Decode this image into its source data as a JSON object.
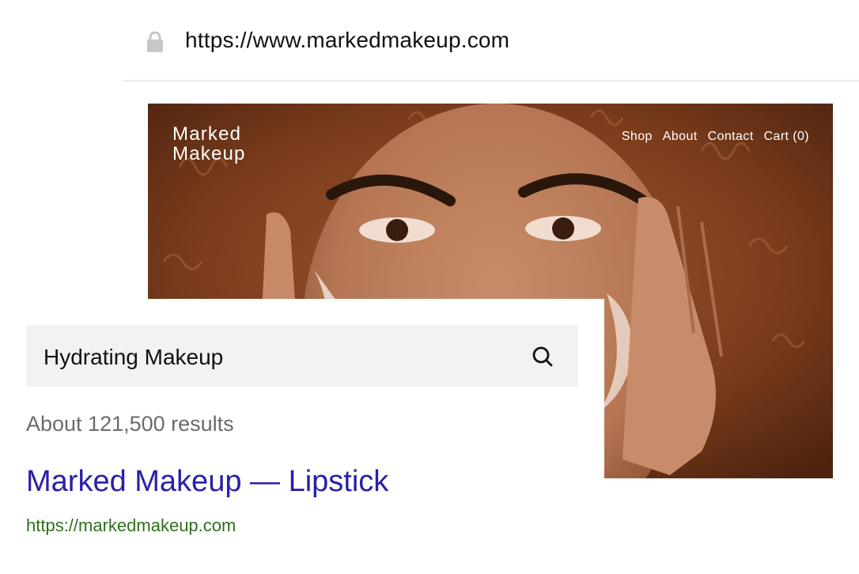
{
  "browser": {
    "url": "https://www.markedmakeup.com",
    "lock_icon": "lock-icon"
  },
  "website": {
    "logo": "Marked\nMakeup",
    "nav": {
      "shop": "Shop",
      "about": "About",
      "contact": "Contact",
      "cart": "Cart (0)"
    }
  },
  "search": {
    "query": "Hydrating Makeup",
    "icon": "search-icon",
    "results_count": "About 121,500 results",
    "result": {
      "title": "Marked Makeup — Lipstick",
      "url": "https://markedmakeup.com"
    }
  },
  "colors": {
    "result_title": "#2a20a8",
    "result_url": "#2f6f1e",
    "results_count": "#6b6b6b"
  }
}
